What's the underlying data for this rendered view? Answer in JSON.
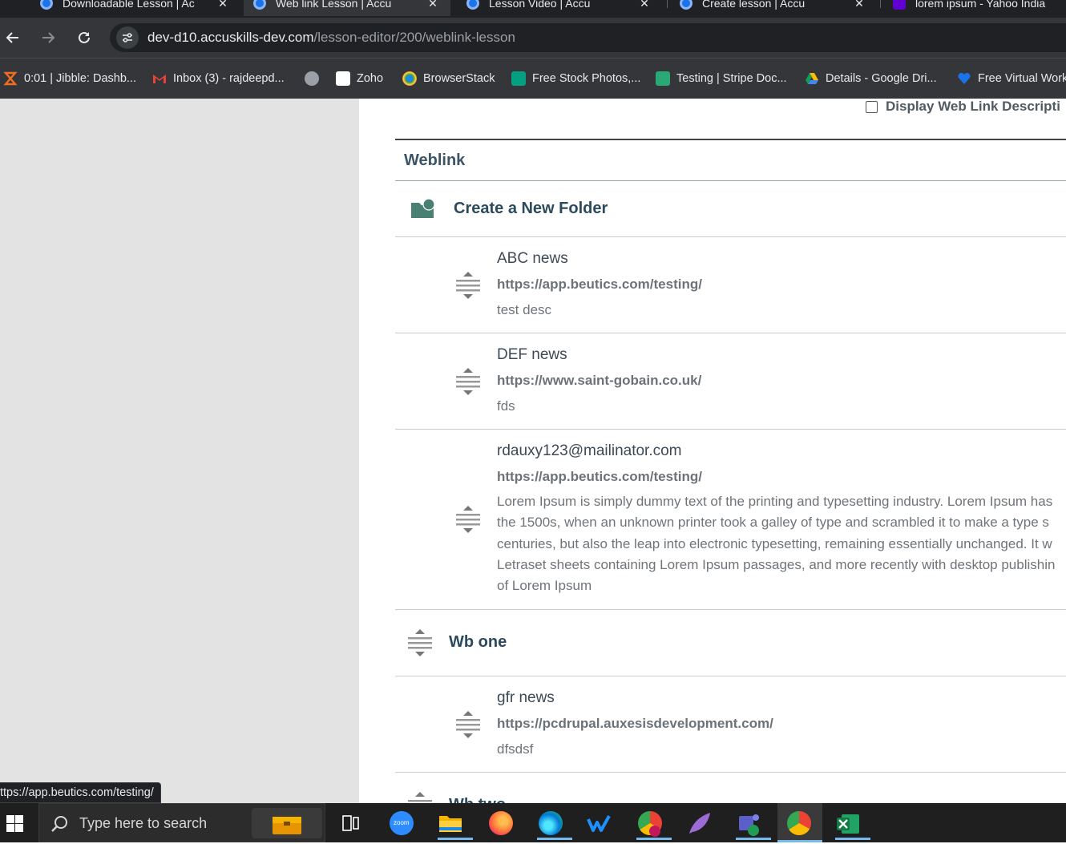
{
  "browser": {
    "tabs": [
      {
        "title": "Downloadable Lesson | Ac",
        "active": false,
        "icon": "globe-icon"
      },
      {
        "title": "Web link Lesson | Accu",
        "active": true,
        "icon": "globe-icon"
      },
      {
        "title": "Lesson Video | Accu",
        "active": false,
        "icon": "globe-icon"
      },
      {
        "title": "Create lesson | Accu",
        "active": false,
        "icon": "globe-icon"
      },
      {
        "title": "lorem ipsum - Yahoo India",
        "active": false,
        "icon": "yahoo-icon"
      }
    ],
    "url_host": "dev-d10.accuskills-dev.com",
    "url_path": "/lesson-editor/200/weblink-lesson",
    "bookmarks": [
      {
        "label": "0:01 | Jibble: Dashb...",
        "color": "#f26c21"
      },
      {
        "label": "Inbox (3) - rajdeepd...",
        "color": "#ea4335"
      },
      {
        "label": "",
        "color": "#9aa0a6"
      },
      {
        "label": "Zoho",
        "color": "#ffffff"
      },
      {
        "label": "BrowserStack",
        "color": "#e69e1c"
      },
      {
        "label": "Free Stock Photos,...",
        "color": "#05a081"
      },
      {
        "label": "Testing | Stripe Doc...",
        "color": "#2aa876"
      },
      {
        "label": "Details - Google Dri...",
        "color": "#fbbc04"
      },
      {
        "label": "Free Virtual Work",
        "color": "#1a73e8"
      }
    ],
    "status_url": "ttps://app.beutics.com/testing/"
  },
  "editor": {
    "display_desc_label": "Display Web Link Descripti",
    "section_title": "Weblink",
    "create_folder_label": "Create a New Folder",
    "links": [
      {
        "title": "ABC news",
        "url": "https://app.beutics.com/testing/",
        "desc": "test desc"
      },
      {
        "title": "DEF news",
        "url": "https://www.saint-gobain.co.uk/",
        "desc": "fds"
      },
      {
        "title": "rdauxy123@mailinator.com",
        "url": "https://app.beutics.com/testing/",
        "desc_lines": [
          "Lorem Ipsum is simply dummy text of the printing and typesetting industry. Lorem Ipsum has",
          "the 1500s, when an unknown printer took a galley of type and scrambled it to make a type s",
          "centuries, but also the leap into electronic typesetting, remaining essentially unchanged. It w",
          "Letraset sheets containing Lorem Ipsum passages, and more recently with desktop publishin",
          "of Lorem Ipsum"
        ]
      }
    ],
    "group_one": "Wb one",
    "group_one_link": {
      "title": "gfr news",
      "url": "https://pcdrupal.auxesisdevelopment.com/",
      "desc": "dfsdsf"
    },
    "group_two": "Wb two"
  },
  "taskbar": {
    "search_placeholder": "Type here to search",
    "apps": [
      "task-view-icon",
      "zoom-icon",
      "file-explorer-icon",
      "firefox-icon",
      "edge-icon",
      "wrike-icon",
      "chrome-profile-icon",
      "feather-icon",
      "teams-icon",
      "chrome-icon",
      "excel-icon"
    ],
    "zoom_label": "zoom"
  },
  "colors": {
    "accent_dark": "#2b4a5c",
    "folder_green": "#4a8073"
  }
}
